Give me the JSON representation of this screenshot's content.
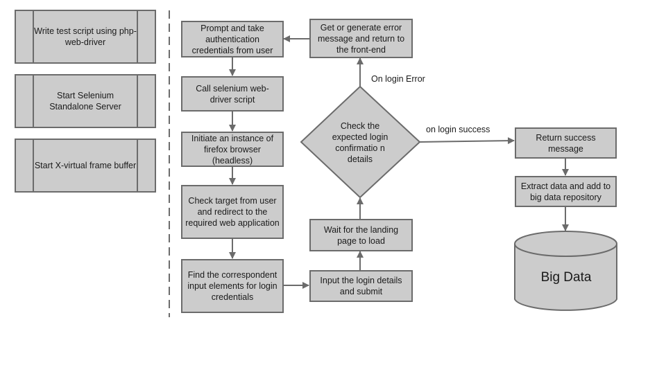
{
  "setup_steps": [
    {
      "label": "Write test script using php-web-driver"
    },
    {
      "label": "Start Selenium Standalone Server"
    },
    {
      "label": "Start X-virtual frame buffer"
    }
  ],
  "flow_steps": {
    "prompt": "Prompt and take authentication credentials from user",
    "call_script": "Call selenium web-driver script",
    "initiate_browser": "Initiate an instance of firefox browser (headless)",
    "check_target": "Check target from user and redirect to the required web application",
    "find_inputs": "Find the correspondent input elements for login credentials",
    "input_login": "Input the login details and submit",
    "wait_landing": "Wait for the landing page to load",
    "decision": "Check the expected login confirmatio n details",
    "error_message": "Get or generate error message and return to the front-end",
    "return_success": "Return success message",
    "extract_data": "Extract data and add to big data repository",
    "database": "Big Data"
  },
  "edge_labels": {
    "on_error": "On login Error",
    "on_success": "on login success"
  },
  "colors": {
    "fill": "#cccccc",
    "stroke": "#6b6b6b",
    "text": "#1a1a1a"
  }
}
